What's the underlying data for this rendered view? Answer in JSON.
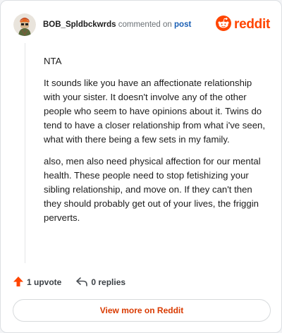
{
  "header": {
    "username": "BOB_Spldbckwrds",
    "action_text": "commented on",
    "post_link": "post",
    "brand_name": "reddit"
  },
  "comment": {
    "paragraphs": [
      "NTA",
      "It sounds like you have an affectionate relationship with your sister. It doesn't involve any of the other people who seem to have opinions about it. Twins do tend to have a closer relationship from what i've seen, what with there being a few sets in my family.",
      "also, men also need physical affection for our mental health. These people need to stop fetishizing your sibling relationship, and move on. If they can't then they should probably get out of your lives, the friggin perverts."
    ]
  },
  "actions": {
    "upvote_label": "1 upvote",
    "replies_label": "0 replies"
  },
  "footer": {
    "view_more_label": "View more on Reddit"
  },
  "colors": {
    "brand": "#ff4500",
    "link": "#1a5fb4",
    "view_more": "#d93a00"
  },
  "icons": [
    "avatar",
    "reddit-logo-icon",
    "upvote-icon",
    "reply-icon"
  ]
}
